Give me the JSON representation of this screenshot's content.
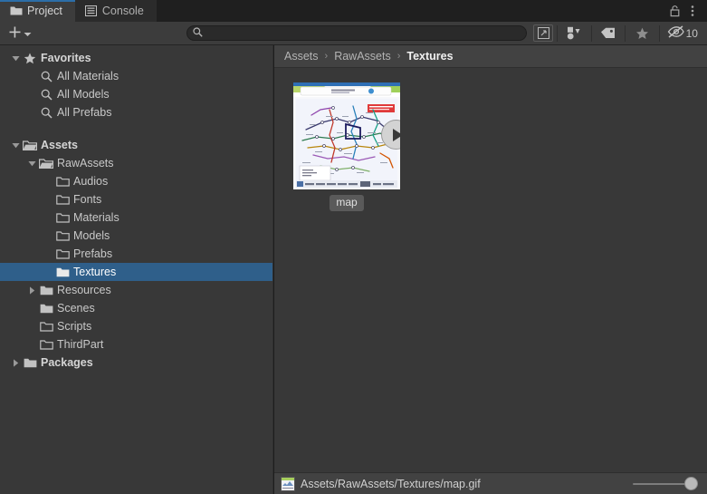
{
  "tabs": [
    {
      "label": "Project",
      "icon": "folder-icon",
      "active": true
    },
    {
      "label": "Console",
      "icon": "console-lines-icon",
      "active": false
    }
  ],
  "tabbar_right": {
    "lock_icon": "lock-open-icon",
    "menu_icon": "kebab-menu-icon"
  },
  "toolbar": {
    "create_label": "+",
    "create_dropdown_icon": "chevron-down-icon",
    "search_placeholder": "",
    "search_value": "",
    "search_icon": "search-icon",
    "save_search_icon": "save-search-icon",
    "filter_type_icon": "filter-by-type-icon",
    "filter_label_icon": "filter-by-label-icon",
    "filter_favorite_icon": "filter-by-favorite-icon",
    "hidden_icon": "eye-crossed-icon",
    "hidden_count": "10"
  },
  "sidebar": {
    "items": [
      {
        "label": "Favorites",
        "depth": 0,
        "arrow": "down",
        "icon": "star-icon",
        "bold": true,
        "selected": false
      },
      {
        "label": "All Materials",
        "depth": 1,
        "arrow": "none",
        "icon": "search-icon",
        "bold": false,
        "selected": false
      },
      {
        "label": "All Models",
        "depth": 1,
        "arrow": "none",
        "icon": "search-icon",
        "bold": false,
        "selected": false
      },
      {
        "label": "All Prefabs",
        "depth": 1,
        "arrow": "none",
        "icon": "search-icon",
        "bold": false,
        "selected": false
      },
      {
        "label": "",
        "depth": 0,
        "arrow": "none",
        "icon": "none",
        "bold": false,
        "selected": false
      },
      {
        "label": "Assets",
        "depth": 0,
        "arrow": "down",
        "icon": "folder-open-icon",
        "bold": true,
        "selected": false
      },
      {
        "label": "RawAssets",
        "depth": 1,
        "arrow": "down",
        "icon": "folder-open-icon",
        "bold": false,
        "selected": false
      },
      {
        "label": "Audios",
        "depth": 2,
        "arrow": "none",
        "icon": "folder-empty-icon",
        "bold": false,
        "selected": false
      },
      {
        "label": "Fonts",
        "depth": 2,
        "arrow": "none",
        "icon": "folder-empty-icon",
        "bold": false,
        "selected": false
      },
      {
        "label": "Materials",
        "depth": 2,
        "arrow": "none",
        "icon": "folder-empty-icon",
        "bold": false,
        "selected": false
      },
      {
        "label": "Models",
        "depth": 2,
        "arrow": "none",
        "icon": "folder-empty-icon",
        "bold": false,
        "selected": false
      },
      {
        "label": "Prefabs",
        "depth": 2,
        "arrow": "none",
        "icon": "folder-empty-icon",
        "bold": false,
        "selected": false
      },
      {
        "label": "Textures",
        "depth": 2,
        "arrow": "none",
        "icon": "folder-filled-icon",
        "bold": false,
        "selected": true
      },
      {
        "label": "Resources",
        "depth": 1,
        "arrow": "right",
        "icon": "folder-filled-icon",
        "bold": false,
        "selected": false
      },
      {
        "label": "Scenes",
        "depth": 1,
        "arrow": "none",
        "icon": "folder-filled-icon",
        "bold": false,
        "selected": false
      },
      {
        "label": "Scripts",
        "depth": 1,
        "arrow": "none",
        "icon": "folder-empty-icon",
        "bold": false,
        "selected": false
      },
      {
        "label": "ThirdPart",
        "depth": 1,
        "arrow": "none",
        "icon": "folder-empty-icon",
        "bold": false,
        "selected": false
      },
      {
        "label": "Packages",
        "depth": 0,
        "arrow": "right",
        "icon": "folder-filled-icon",
        "bold": true,
        "selected": false
      }
    ]
  },
  "breadcrumb": {
    "items": [
      "Assets",
      "RawAssets",
      "Textures"
    ],
    "separator": "›"
  },
  "grid": {
    "assets": [
      {
        "name": "map",
        "type": "gif",
        "has_play_overlay": true,
        "selected": false
      }
    ]
  },
  "statusbar": {
    "path": "Assets/RawAssets/Textures/map.gif",
    "icon": "image-thumbnail-icon",
    "zoom_slider_value": 100
  },
  "colors": {
    "window_bg": "#383838",
    "tabbar_bg": "#1f1f1f",
    "tab_active_bg": "#3c3c3c",
    "tab_accent": "#2c6ea8",
    "toolbar_bg": "#3c3c3c",
    "breadcrumb_bg": "#424242",
    "selection_blue": "#2f5f8a",
    "text": "#c4c4c4",
    "text_bright": "#f0f0f0"
  }
}
